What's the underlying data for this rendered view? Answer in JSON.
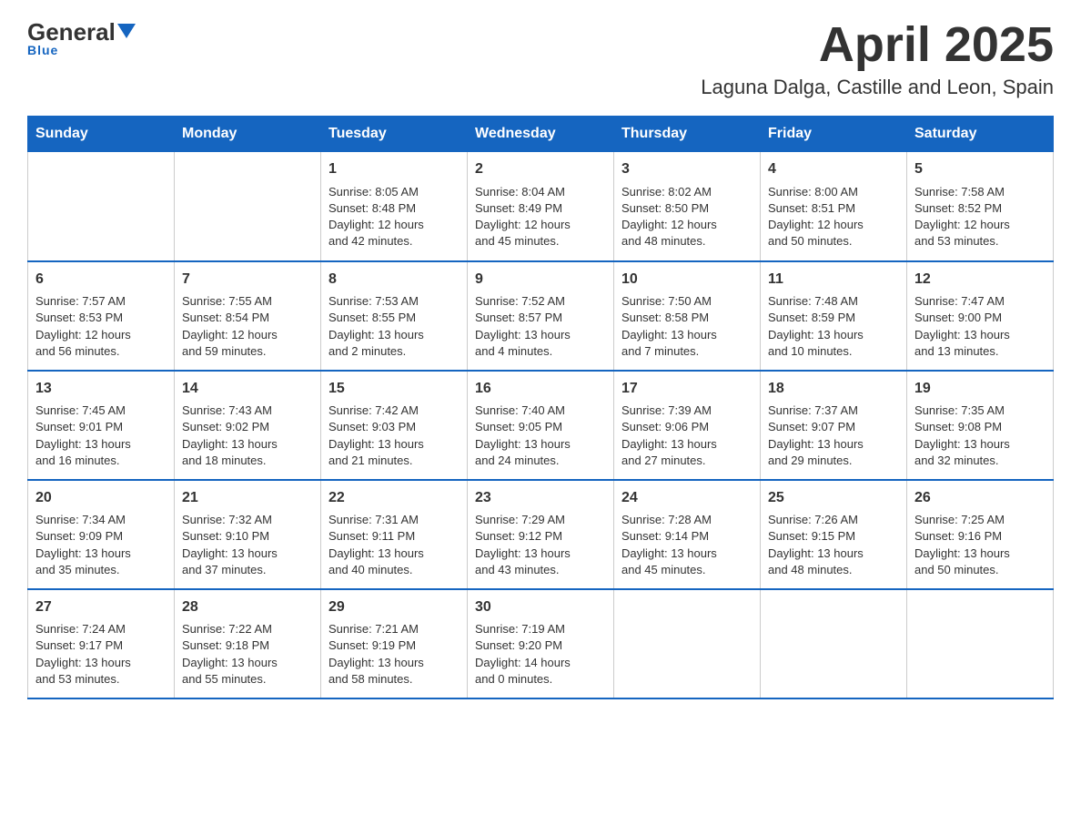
{
  "logo": {
    "general": "General",
    "blue": "Blue",
    "tagline": "Blue"
  },
  "header": {
    "month": "April 2025",
    "location": "Laguna Dalga, Castille and Leon, Spain"
  },
  "weekdays": [
    "Sunday",
    "Monday",
    "Tuesday",
    "Wednesday",
    "Thursday",
    "Friday",
    "Saturday"
  ],
  "weeks": [
    [
      {
        "day": "",
        "info": ""
      },
      {
        "day": "",
        "info": ""
      },
      {
        "day": "1",
        "info": "Sunrise: 8:05 AM\nSunset: 8:48 PM\nDaylight: 12 hours\nand 42 minutes."
      },
      {
        "day": "2",
        "info": "Sunrise: 8:04 AM\nSunset: 8:49 PM\nDaylight: 12 hours\nand 45 minutes."
      },
      {
        "day": "3",
        "info": "Sunrise: 8:02 AM\nSunset: 8:50 PM\nDaylight: 12 hours\nand 48 minutes."
      },
      {
        "day": "4",
        "info": "Sunrise: 8:00 AM\nSunset: 8:51 PM\nDaylight: 12 hours\nand 50 minutes."
      },
      {
        "day": "5",
        "info": "Sunrise: 7:58 AM\nSunset: 8:52 PM\nDaylight: 12 hours\nand 53 minutes."
      }
    ],
    [
      {
        "day": "6",
        "info": "Sunrise: 7:57 AM\nSunset: 8:53 PM\nDaylight: 12 hours\nand 56 minutes."
      },
      {
        "day": "7",
        "info": "Sunrise: 7:55 AM\nSunset: 8:54 PM\nDaylight: 12 hours\nand 59 minutes."
      },
      {
        "day": "8",
        "info": "Sunrise: 7:53 AM\nSunset: 8:55 PM\nDaylight: 13 hours\nand 2 minutes."
      },
      {
        "day": "9",
        "info": "Sunrise: 7:52 AM\nSunset: 8:57 PM\nDaylight: 13 hours\nand 4 minutes."
      },
      {
        "day": "10",
        "info": "Sunrise: 7:50 AM\nSunset: 8:58 PM\nDaylight: 13 hours\nand 7 minutes."
      },
      {
        "day": "11",
        "info": "Sunrise: 7:48 AM\nSunset: 8:59 PM\nDaylight: 13 hours\nand 10 minutes."
      },
      {
        "day": "12",
        "info": "Sunrise: 7:47 AM\nSunset: 9:00 PM\nDaylight: 13 hours\nand 13 minutes."
      }
    ],
    [
      {
        "day": "13",
        "info": "Sunrise: 7:45 AM\nSunset: 9:01 PM\nDaylight: 13 hours\nand 16 minutes."
      },
      {
        "day": "14",
        "info": "Sunrise: 7:43 AM\nSunset: 9:02 PM\nDaylight: 13 hours\nand 18 minutes."
      },
      {
        "day": "15",
        "info": "Sunrise: 7:42 AM\nSunset: 9:03 PM\nDaylight: 13 hours\nand 21 minutes."
      },
      {
        "day": "16",
        "info": "Sunrise: 7:40 AM\nSunset: 9:05 PM\nDaylight: 13 hours\nand 24 minutes."
      },
      {
        "day": "17",
        "info": "Sunrise: 7:39 AM\nSunset: 9:06 PM\nDaylight: 13 hours\nand 27 minutes."
      },
      {
        "day": "18",
        "info": "Sunrise: 7:37 AM\nSunset: 9:07 PM\nDaylight: 13 hours\nand 29 minutes."
      },
      {
        "day": "19",
        "info": "Sunrise: 7:35 AM\nSunset: 9:08 PM\nDaylight: 13 hours\nand 32 minutes."
      }
    ],
    [
      {
        "day": "20",
        "info": "Sunrise: 7:34 AM\nSunset: 9:09 PM\nDaylight: 13 hours\nand 35 minutes."
      },
      {
        "day": "21",
        "info": "Sunrise: 7:32 AM\nSunset: 9:10 PM\nDaylight: 13 hours\nand 37 minutes."
      },
      {
        "day": "22",
        "info": "Sunrise: 7:31 AM\nSunset: 9:11 PM\nDaylight: 13 hours\nand 40 minutes."
      },
      {
        "day": "23",
        "info": "Sunrise: 7:29 AM\nSunset: 9:12 PM\nDaylight: 13 hours\nand 43 minutes."
      },
      {
        "day": "24",
        "info": "Sunrise: 7:28 AM\nSunset: 9:14 PM\nDaylight: 13 hours\nand 45 minutes."
      },
      {
        "day": "25",
        "info": "Sunrise: 7:26 AM\nSunset: 9:15 PM\nDaylight: 13 hours\nand 48 minutes."
      },
      {
        "day": "26",
        "info": "Sunrise: 7:25 AM\nSunset: 9:16 PM\nDaylight: 13 hours\nand 50 minutes."
      }
    ],
    [
      {
        "day": "27",
        "info": "Sunrise: 7:24 AM\nSunset: 9:17 PM\nDaylight: 13 hours\nand 53 minutes."
      },
      {
        "day": "28",
        "info": "Sunrise: 7:22 AM\nSunset: 9:18 PM\nDaylight: 13 hours\nand 55 minutes."
      },
      {
        "day": "29",
        "info": "Sunrise: 7:21 AM\nSunset: 9:19 PM\nDaylight: 13 hours\nand 58 minutes."
      },
      {
        "day": "30",
        "info": "Sunrise: 7:19 AM\nSunset: 9:20 PM\nDaylight: 14 hours\nand 0 minutes."
      },
      {
        "day": "",
        "info": ""
      },
      {
        "day": "",
        "info": ""
      },
      {
        "day": "",
        "info": ""
      }
    ]
  ]
}
